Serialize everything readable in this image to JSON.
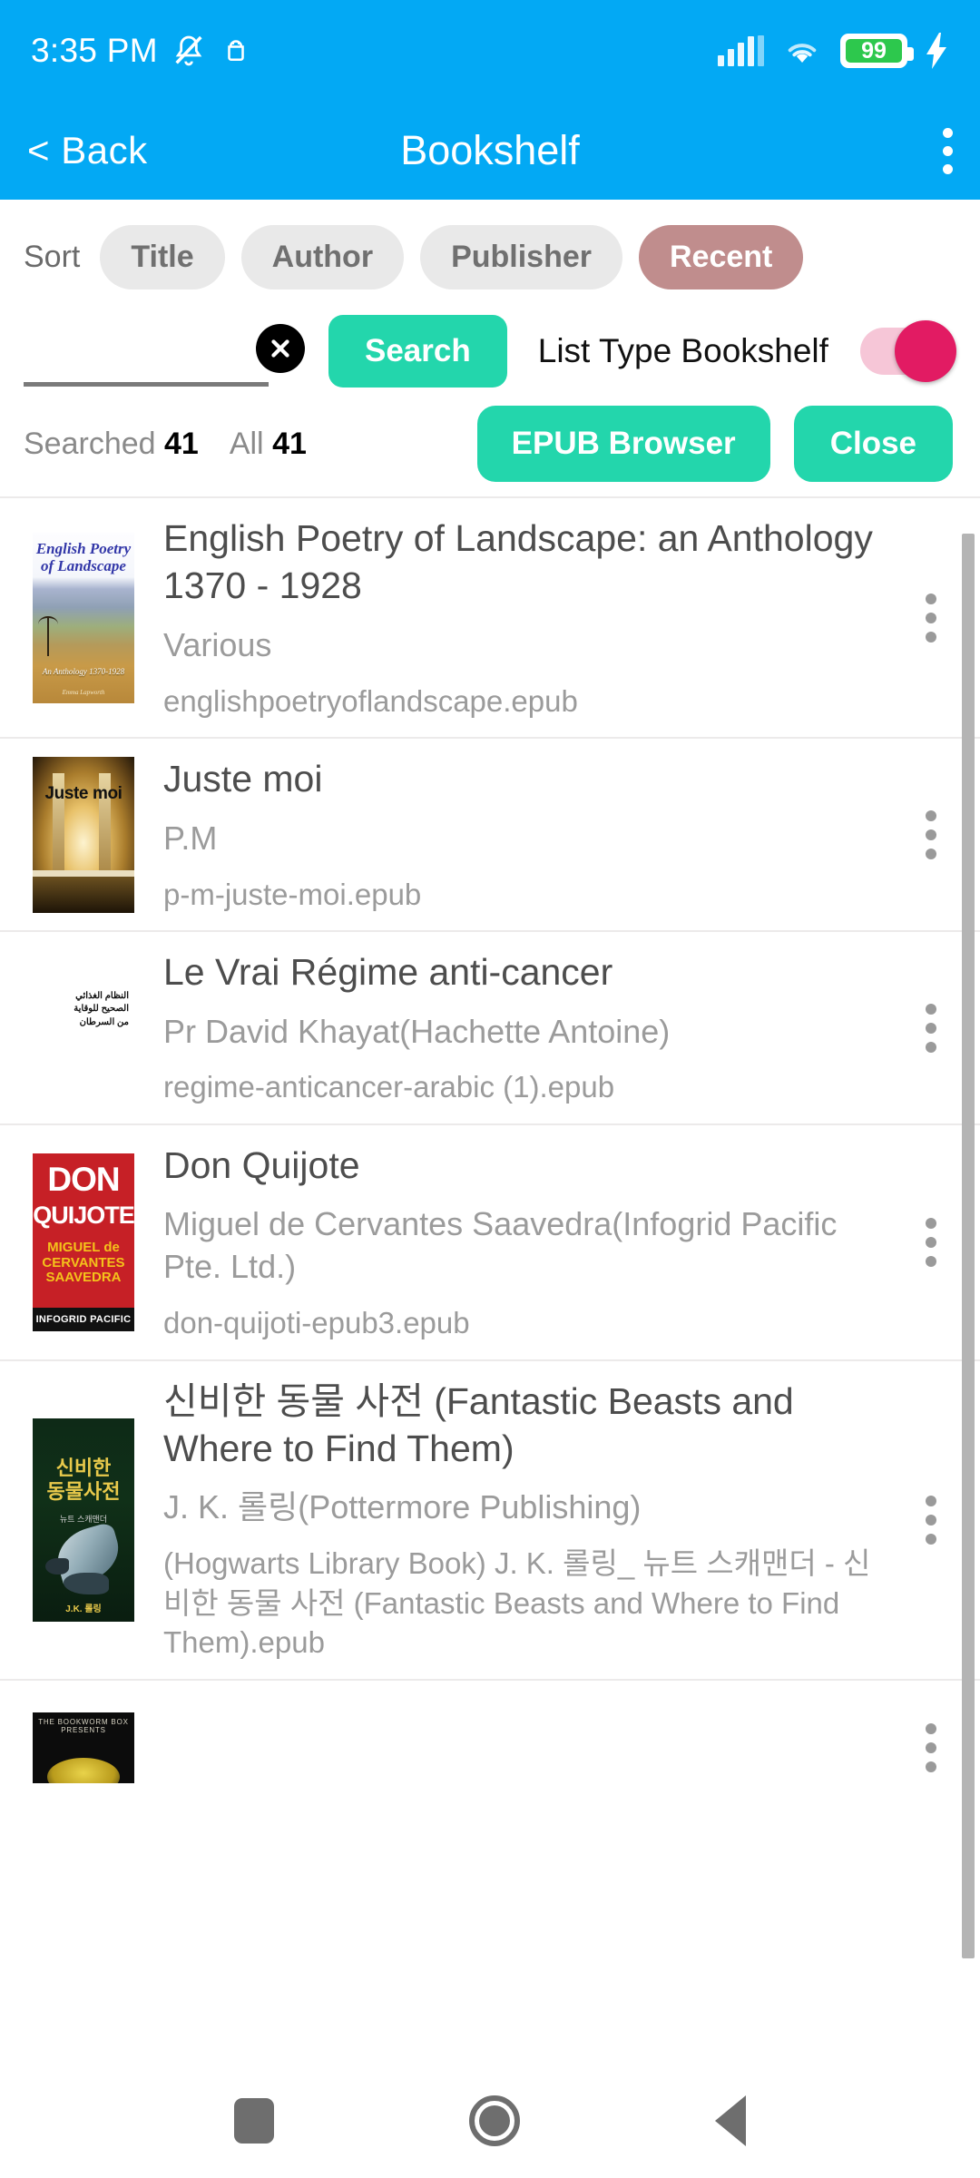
{
  "status_bar": {
    "time": "3:35 PM",
    "icons": [
      "mute-bell-icon",
      "android-icon",
      "signal-icon",
      "wifi-icon",
      "battery-icon",
      "charging-bolt-icon"
    ],
    "battery_level": "99",
    "battery_color": "#2DC84D"
  },
  "app_bar": {
    "back_label": "< Back",
    "title": "Bookshelf",
    "overflow_icon": "three-dots-vertical-icon",
    "background": "#03A9F4"
  },
  "sort": {
    "label": "Sort",
    "options": [
      {
        "label": "Title",
        "active": false
      },
      {
        "label": "Author",
        "active": false
      },
      {
        "label": "Publisher",
        "active": false
      },
      {
        "label": "Recent",
        "active": true
      }
    ],
    "active_color": "#C08D8D",
    "inactive_color": "#E9E9E9"
  },
  "search": {
    "value": "",
    "placeholder": "",
    "clear_icon": "close-circle-icon",
    "button_label": "Search",
    "button_color": "#23D6AC"
  },
  "list_type": {
    "label": "List Type Bookshelf",
    "toggle_on": true,
    "track_color": "#F6C6D7",
    "knob_color": "#E21B63"
  },
  "counts": {
    "searched_label": "Searched",
    "searched_value": "41",
    "all_label": "All",
    "all_value": "41"
  },
  "actions": {
    "epub_browser_label": "EPUB Browser",
    "close_label": "Close"
  },
  "books": [
    {
      "title": "English Poetry of Landscape: an Anthology 1370 - 1928",
      "author": "Various",
      "filename": "englishpoetryoflandscape.epub",
      "cover": {
        "style": "poetry",
        "title_line1": "English  Poetry",
        "title_line2": "of Landscape",
        "subtitle": "An Anthology 1370-1928",
        "author_credit": "Emma Lapworth"
      },
      "menu_icon": "three-dots-vertical-icon"
    },
    {
      "title": "Juste moi",
      "author": "P.M",
      "filename": "p-m-juste-moi.epub",
      "cover": {
        "style": "juste",
        "title_text": "Juste moi"
      },
      "menu_icon": "three-dots-vertical-icon"
    },
    {
      "title": "Le Vrai Régime anti-cancer",
      "author": "Pr David Khayat(Hachette Antoine)",
      "filename": "regime-anticancer-arabic (1).epub",
      "cover": {
        "style": "arabic",
        "arabic_text": "النظام الغذائي\nالصحيح للوقاية\nمن السرطان"
      },
      "menu_icon": "three-dots-vertical-icon"
    },
    {
      "title": "Don Quijote",
      "author": "Miguel de Cervantes Saavedra(Infogrid Pacific Pte. Ltd.)",
      "filename": "don-quijoti-epub3.epub",
      "cover": {
        "style": "don",
        "line1": "DON",
        "line2": "QUIJOTE",
        "line3": "MIGUEL de\nCERVANTES\nSAAVEDRA",
        "footer": "INFOGRID PACIFIC"
      },
      "menu_icon": "three-dots-vertical-icon"
    },
    {
      "title": "신비한 동물 사전 (Fantastic Beasts and Where to Find Them)",
      "author": "J. K. 롤링(Pottermore Publishing)",
      "filename": "(Hogwarts Library Book) J. K. 롤링_ 뉴트 스캐맨더 - 신비한 동물 사전 (Fantastic Beasts and Where to Find Them).epub",
      "cover": {
        "style": "beast",
        "title_line1": "신비한",
        "title_line2": "동물사전",
        "subtitle": "뉴트 스캐맨더",
        "author_credit": "J.K. 롤링"
      },
      "menu_icon": "three-dots-vertical-icon"
    },
    {
      "title": "",
      "author": "",
      "filename": "",
      "cover": {
        "style": "worm",
        "banner": "THE BOOKWORM BOX PRESENTS"
      },
      "menu_icon": "three-dots-vertical-icon"
    }
  ],
  "nav_bar": {
    "recents_icon": "square-recents-icon",
    "home_icon": "circle-home-icon",
    "back_icon": "triangle-back-icon"
  }
}
